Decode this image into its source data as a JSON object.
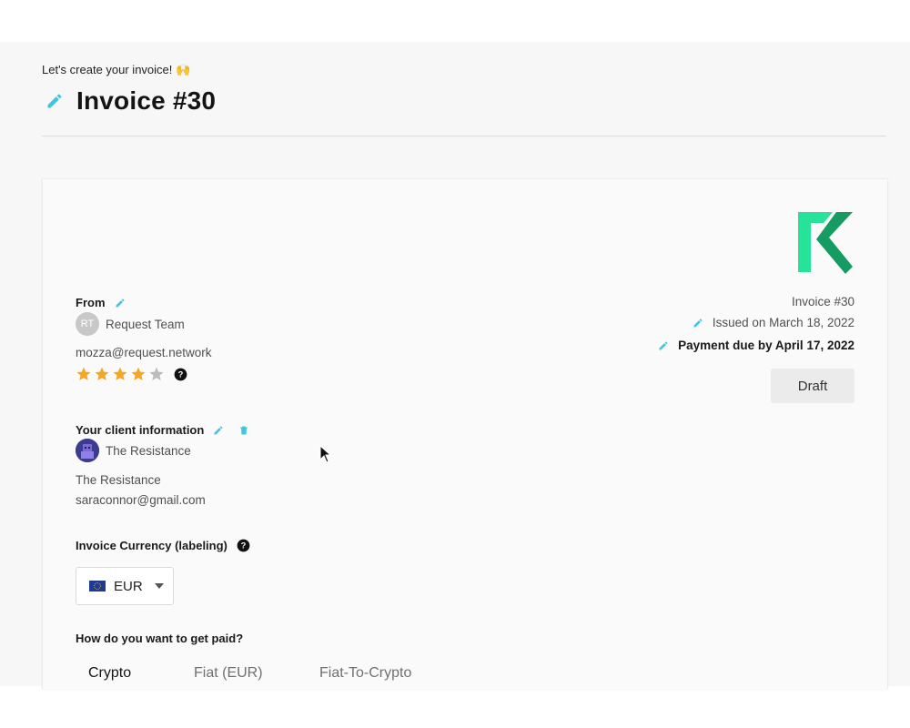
{
  "header": {
    "greeting": "Let's create your invoice! 🙌",
    "title": "Invoice #30"
  },
  "sender": {
    "section_label": "From",
    "avatar_initials": "RT",
    "name": "Request Team",
    "email": "mozza@request.network",
    "rating": 4,
    "rating_max": 5
  },
  "client": {
    "section_label": "Your client information",
    "name": "The Resistance",
    "company": "The Resistance",
    "email": "saraconnor@gmail.com"
  },
  "invoice_meta": {
    "number": "Invoice #30",
    "issued": "Issued on March 18, 2022",
    "due": "Payment due by April 17, 2022",
    "status": "Draft"
  },
  "currency": {
    "label": "Invoice Currency (labeling)",
    "selected": "EUR"
  },
  "payment": {
    "question": "How do you want to get paid?",
    "tabs": [
      "Crypto",
      "Fiat (EUR)",
      "Fiat-To-Crypto"
    ],
    "active_tab": "Crypto"
  },
  "colors": {
    "accent": "#3ec6e0",
    "logo_green_light": "#27e39a",
    "logo_green_dark": "#169b62",
    "star_filled": "#f5a623",
    "star_empty": "#bdbdbd"
  },
  "icons": {
    "edit": "pencil-icon",
    "delete": "trash-icon",
    "help": "question-circle-icon",
    "dropdown": "chevron-down-icon",
    "flag": "eu-flag-icon",
    "cursor": "mouse-cursor-icon"
  }
}
